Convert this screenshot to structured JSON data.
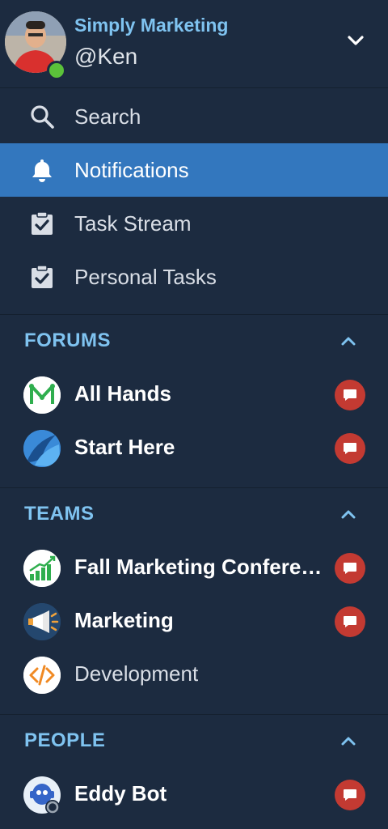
{
  "header": {
    "org_name": "Simply Marketing",
    "handle": "@Ken",
    "status": "online"
  },
  "nav": [
    {
      "label": "Search",
      "icon": "search-icon",
      "active": false
    },
    {
      "label": "Notifications",
      "icon": "bell-icon",
      "active": true
    },
    {
      "label": "Task Stream",
      "icon": "clipboard-check-icon",
      "active": false
    },
    {
      "label": "Personal Tasks",
      "icon": "clipboard-check-icon",
      "active": false
    }
  ],
  "sections": {
    "forums": {
      "title": "FORUMS",
      "items": [
        {
          "label": "All Hands",
          "icon": "all-hands-logo-icon",
          "unread": true
        },
        {
          "label": "Start Here",
          "icon": "start-here-logo-icon",
          "unread": true
        }
      ]
    },
    "teams": {
      "title": "TEAMS",
      "items": [
        {
          "label": "Fall Marketing Conference",
          "icon": "bar-chart-logo-icon",
          "unread": true
        },
        {
          "label": "Marketing",
          "icon": "megaphone-logo-icon",
          "unread": true
        },
        {
          "label": "Development",
          "icon": "code-logo-icon",
          "unread": false
        }
      ]
    },
    "people": {
      "title": "PEOPLE",
      "items": [
        {
          "label": "Eddy Bot",
          "icon": "robot-avatar-icon",
          "unread": true
        }
      ]
    }
  },
  "colors": {
    "background": "#1c2b40",
    "accent": "#3377be",
    "heading": "#7fc3f0",
    "badge": "#c33a32",
    "online": "#5bc23a"
  }
}
